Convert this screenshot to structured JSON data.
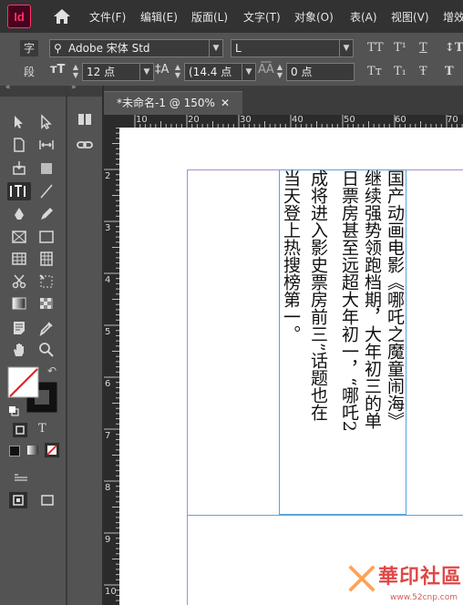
{
  "app": {
    "logo_text": "Id"
  },
  "menu": {
    "items": [
      "文件(F)",
      "编辑(E)",
      "版面(L)",
      "文字(T)",
      "对象(O)",
      "表(A)",
      "视图(V)",
      "增效"
    ]
  },
  "control": {
    "char_label": "字",
    "para_label": "段",
    "font_family": "Adobe 宋体 Std",
    "font_style": "L",
    "font_size": "12 点",
    "leading": "(14.4 点",
    "tracking": "0 点",
    "tt_buttons": [
      "TT",
      "T¹",
      "T",
      "Tт",
      "T₁",
      "Ŧ"
    ]
  },
  "document": {
    "tab_label": "*未命名-1 @ 150%",
    "ruler_h": [
      "10",
      "20",
      "30",
      "40",
      "50",
      "60",
      "70"
    ],
    "ruler_v": [
      "2",
      "3",
      "4",
      "5",
      "6",
      "7",
      "8",
      "9",
      "10"
    ],
    "text_columns": [
      "国产动画电影《哪吒之魔童闹海》",
      "继续强势领跑档期，大年初三的单",
      "日票房甚至远超大年初一，“哪吒2",
      "成将进入影史票房前三”话题也在",
      "当天登上热搜榜第一。"
    ]
  },
  "watermark": {
    "text": "華印社區",
    "url": "www.52cnp.com"
  },
  "colors": {
    "accent": "#ff3366",
    "margin_guide": "#b08ad0",
    "frame_edge": "#5aa5d6",
    "fill_stroke_red": "#e02020"
  }
}
